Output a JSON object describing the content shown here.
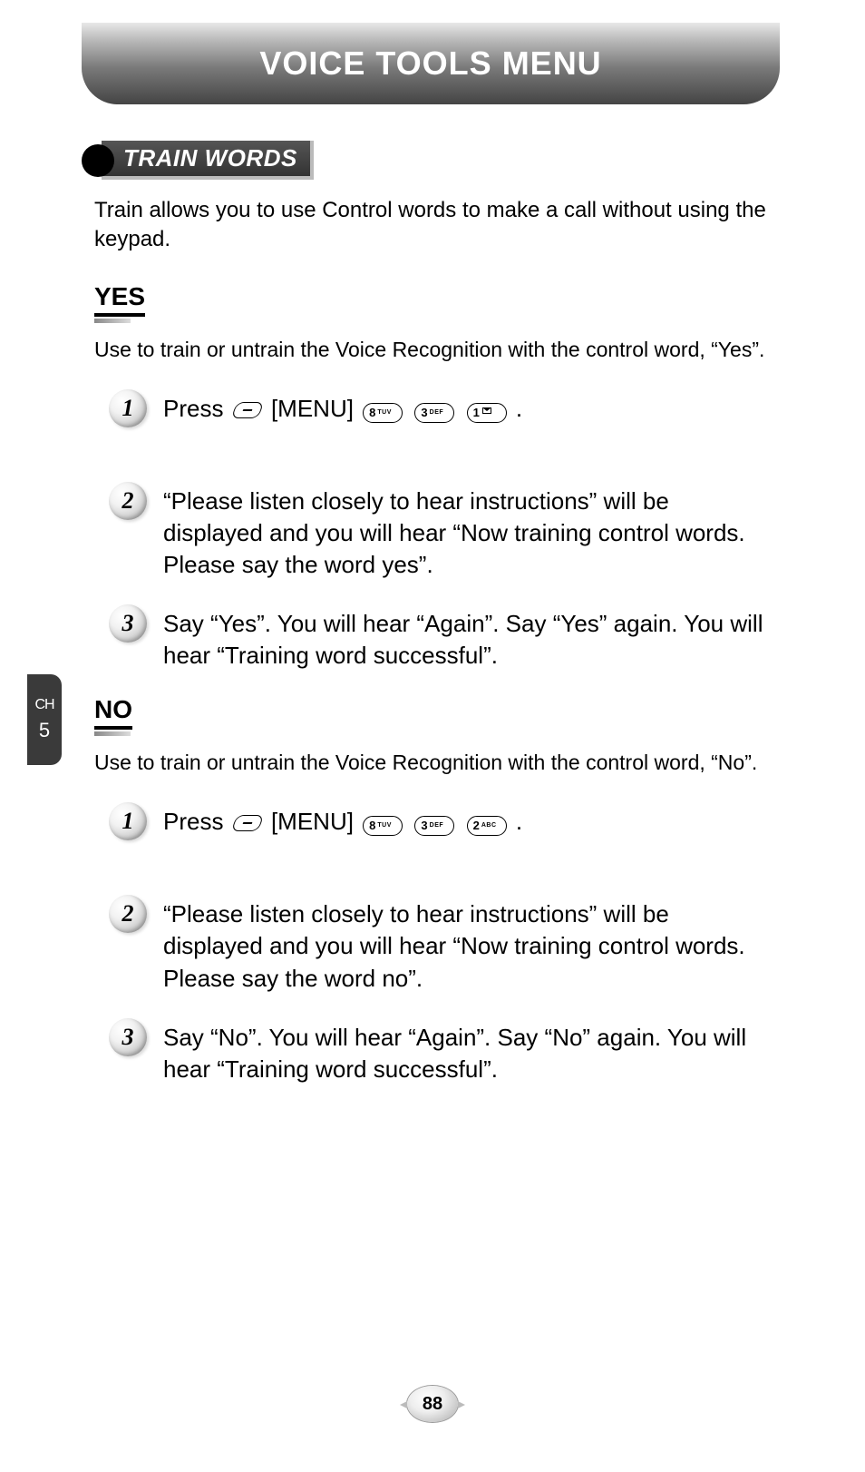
{
  "banner": {
    "title": "VOICE TOOLS MENU"
  },
  "section": {
    "title": "TRAIN WORDS",
    "intro": "Train allows you to use Control words to make a call without using the keypad."
  },
  "yes": {
    "heading": "YES",
    "desc": "Use to train or untrain the Voice Recognition with the control word, “Yes”.",
    "step1_press": "Press",
    "step1_menu": "[MENU]",
    "step1_end": ".",
    "keys": [
      {
        "big": "8",
        "sm": "TUV"
      },
      {
        "big": "3",
        "sm": "DEF"
      },
      {
        "big": "1",
        "sm": "",
        "mail": true
      }
    ],
    "step2": "“Please listen closely to hear instructions” will be displayed and you will hear “Now training control words.  Please say the word yes”.",
    "step3": "Say “Yes”. You will hear “Again”. Say “Yes” again. You will hear “Training word successful”."
  },
  "no": {
    "heading": "NO",
    "desc": "Use to train or untrain the Voice Recognition with the control word, “No”.",
    "step1_press": "Press",
    "step1_menu": "[MENU]",
    "step1_end": ".",
    "keys": [
      {
        "big": "8",
        "sm": "TUV"
      },
      {
        "big": "3",
        "sm": "DEF"
      },
      {
        "big": "2",
        "sm": "ABC"
      }
    ],
    "step2": "“Please listen closely to hear instructions” will be displayed and you will hear “Now training control words.  Please say the word no”.",
    "step3": "Say “No”. You will hear “Again”. Say “No” again. You will hear “Training word successful”."
  },
  "chapter": {
    "label": "CH",
    "number": "5"
  },
  "page": {
    "number": "88"
  },
  "step_numbers": {
    "s1": "1",
    "s2": "2",
    "s3": "3"
  }
}
